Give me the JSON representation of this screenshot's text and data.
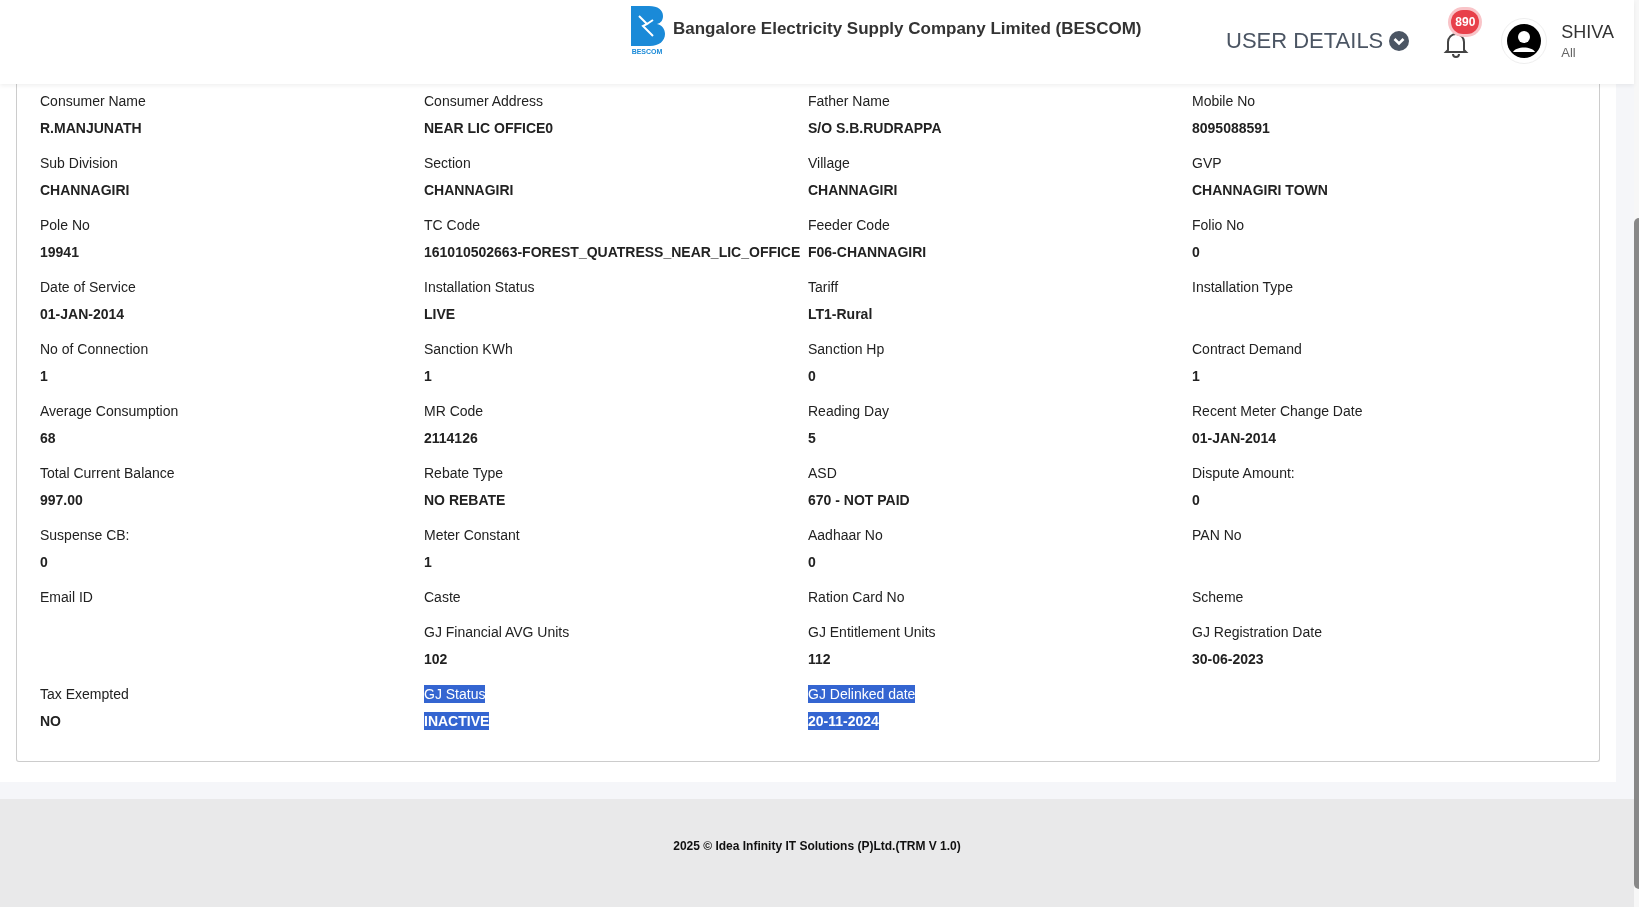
{
  "header": {
    "company": "Bangalore Electricity Supply Company Limited (BESCOM)",
    "logo_caption": "BESCOM",
    "user_details": "USER DETAILS",
    "notifications": "890",
    "user": {
      "name": "SHIVA",
      "role": "All"
    }
  },
  "rows": [
    [
      {
        "kind": "field",
        "label": "Consumer Name",
        "value": "R.MANJUNATH",
        "selected": false
      },
      {
        "kind": "field",
        "label": "Consumer Address",
        "value": "NEAR LIC OFFICE0",
        "selected": false
      },
      {
        "kind": "field",
        "label": "Father Name",
        "value": "S/O S.B.RUDRAPPA",
        "selected": false
      },
      {
        "kind": "field",
        "label": "Mobile No",
        "value": "8095088591",
        "selected": false
      }
    ],
    [
      {
        "kind": "field",
        "label": "Sub Division",
        "value": "CHANNAGIRI",
        "selected": false
      },
      {
        "kind": "field",
        "label": "Section",
        "value": "CHANNAGIRI",
        "selected": false
      },
      {
        "kind": "field",
        "label": "Village",
        "value": "CHANNAGIRI",
        "selected": false
      },
      {
        "kind": "field",
        "label": "GVP",
        "value": "CHANNAGIRI TOWN",
        "selected": false
      }
    ],
    [
      {
        "kind": "field",
        "label": "Pole No",
        "value": "19941",
        "selected": false
      },
      {
        "kind": "field",
        "label": "TC Code",
        "value": "161010502663-FOREST_QUATRESS_NEAR_LIC_OFFICE",
        "selected": false
      },
      {
        "kind": "field",
        "label": "Feeder Code",
        "value": "F06-CHANNAGIRI",
        "selected": false
      },
      {
        "kind": "field",
        "label": "Folio No",
        "value": "0",
        "selected": false
      }
    ],
    [
      {
        "kind": "field",
        "label": "Date of Service",
        "value": "01-JAN-2014",
        "selected": false
      },
      {
        "kind": "field",
        "label": "Installation Status",
        "value": "LIVE",
        "selected": false
      },
      {
        "kind": "field",
        "label": "Tariff",
        "value": "LT1-Rural",
        "selected": false
      },
      {
        "kind": "field",
        "label": "Installation Type",
        "selected": false
      }
    ],
    [
      {
        "kind": "field",
        "label": "No of Connection",
        "value": "1",
        "selected": false
      },
      {
        "kind": "field",
        "label": "Sanction KWh",
        "value": "1",
        "selected": false
      },
      {
        "kind": "field",
        "label": "Sanction Hp",
        "value": "0",
        "selected": false
      },
      {
        "kind": "field",
        "label": "Contract Demand",
        "value": "1",
        "selected": false
      }
    ],
    [
      {
        "kind": "field",
        "label": "Average Consumption",
        "value": "68",
        "selected": false
      },
      {
        "kind": "field",
        "label": "MR Code",
        "value": "2114126",
        "selected": false
      },
      {
        "kind": "field",
        "label": "Reading Day",
        "value": "5",
        "selected": false
      },
      {
        "kind": "field",
        "label": "Recent Meter Change Date",
        "value": "01-JAN-2014",
        "selected": false
      }
    ],
    [
      {
        "kind": "field",
        "label": "Total Current Balance",
        "value": "997.00",
        "selected": false
      },
      {
        "kind": "field",
        "label": "Rebate Type",
        "value": "NO REBATE",
        "selected": false
      },
      {
        "kind": "field",
        "label": "ASD",
        "value": "670 - NOT PAID",
        "selected": false
      },
      {
        "kind": "field",
        "label": "Dispute Amount:",
        "value": "0",
        "selected": false
      }
    ],
    [
      {
        "kind": "field",
        "label": "Suspense CB:",
        "value": "0",
        "selected": false
      },
      {
        "kind": "field",
        "label": "Meter Constant",
        "value": "1",
        "selected": false
      },
      {
        "kind": "field",
        "label": "Aadhaar No",
        "value": "0",
        "selected": false
      },
      {
        "kind": "field",
        "label": "PAN No",
        "selected": false
      }
    ],
    [
      {
        "kind": "field",
        "label": "Email ID",
        "selected": false
      },
      {
        "kind": "field",
        "label": "Caste",
        "selected": false
      },
      {
        "kind": "field",
        "label": "Ration Card No",
        "selected": false
      },
      {
        "kind": "field",
        "label": "Scheme",
        "selected": false
      }
    ],
    [
      {
        "kind": "blank"
      },
      {
        "kind": "field",
        "label": "GJ Financial AVG Units",
        "value": "102",
        "selected": false
      },
      {
        "kind": "field",
        "label": "GJ Entitlement Units",
        "value": "112",
        "selected": false
      },
      {
        "kind": "field",
        "label": "GJ Registration Date",
        "value": "30-06-2023",
        "selected": false
      }
    ],
    [
      {
        "kind": "field",
        "label": "Tax Exempted",
        "value": "NO",
        "selected": false
      },
      {
        "kind": "field",
        "label": "GJ Status",
        "value": "INACTIVE",
        "selected": true
      },
      {
        "kind": "field",
        "label": "GJ Delinked date",
        "value": "20-11-2024",
        "selected": true
      },
      {
        "kind": "blank"
      }
    ]
  ],
  "footer": "2025 © Idea Infinity IT Solutions (P)Ltd.(TRM V 1.0)"
}
